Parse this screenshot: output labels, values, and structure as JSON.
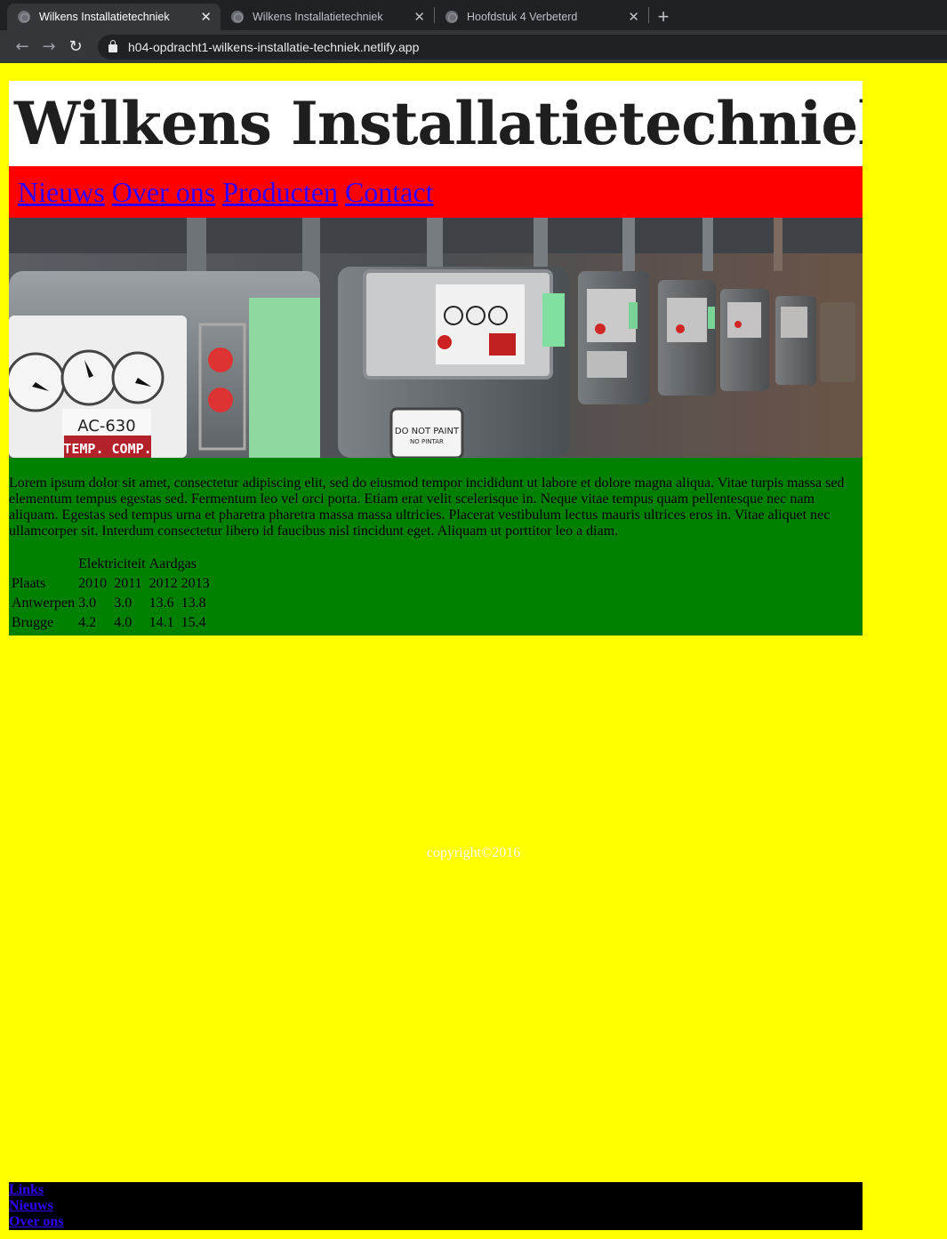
{
  "browser": {
    "tabs": [
      {
        "title": "Wilkens Installatietechniek",
        "active": true
      },
      {
        "title": "Wilkens Installatietechniek",
        "active": false
      },
      {
        "title": "Hoofdstuk 4 Verbeterd",
        "active": false
      }
    ],
    "url": "h04-opdracht1-wilkens-installatie-techniek.netlify.app"
  },
  "header": {
    "logo_text": "Wilkens Installatietechniek"
  },
  "nav": {
    "items": [
      "Nieuws",
      "Over ons",
      "Producten",
      "Contact"
    ]
  },
  "hero": {
    "labels": [
      "AC-630",
      "TEMP. COMP.",
      "DO NOT PAINT",
      "NO PINTAR"
    ]
  },
  "main": {
    "paragraph": "Lorem ipsum dolor sit amet, consectetur adipiscing elit, sed do eiusmod tempor incididunt ut labore et dolore magna aliqua. Vitae turpis massa sed elementum tempus egestas sed. Fermentum leo vel orci porta. Etiam erat velit scelerisque in. Neque vitae tempus quam pellentesque nec nam aliquam. Egestas sed tempus urna et pharetra pharetra massa massa ultricies. Placerat vestibulum lectus mauris ultrices eros in. Vitae aliquet nec ullamcorper sit. Interdum consectetur libero id faucibus nisl tincidunt eget. Aliquam ut porttitor leo a diam.",
    "table": {
      "group_headers": [
        "Elektriciteit",
        "Aardgas"
      ],
      "column_headers": [
        "Plaats",
        "2010",
        "2011",
        "2012",
        "2013"
      ],
      "rows": [
        [
          "Antwerpen",
          "3.0",
          "3.0",
          "13.6",
          "13.8"
        ],
        [
          "Brugge",
          "4.2",
          "4.0",
          "14.1",
          "15.4"
        ]
      ]
    }
  },
  "copyright": "copyright©2016",
  "footer": {
    "links": [
      "Links",
      "Nieuws",
      "Over ons"
    ]
  },
  "colors": {
    "page_bg": "#ffff00",
    "nav_bg": "#ff0000",
    "content_bg": "#008000",
    "footer_bg": "#000000",
    "link": "#3300ff"
  }
}
